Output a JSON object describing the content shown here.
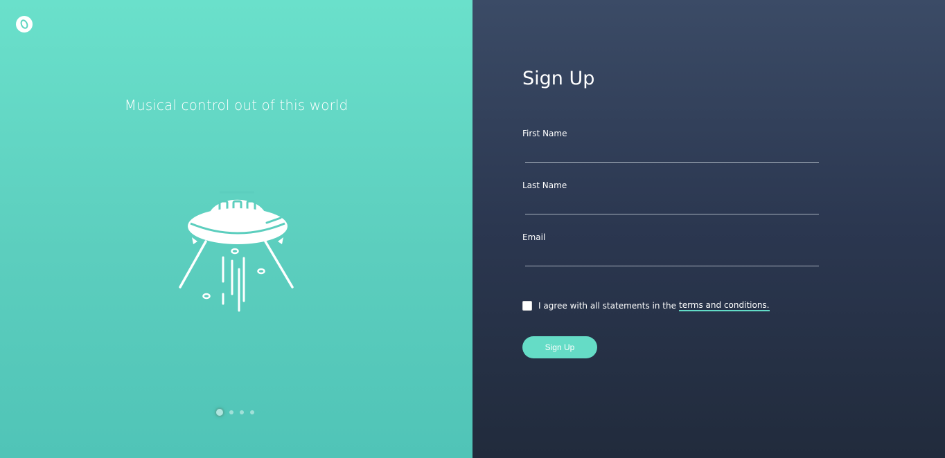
{
  "left": {
    "tagline": "Musical control out of this world",
    "carousel_dots": 4,
    "active_dot": 1
  },
  "form": {
    "title": "Sign Up",
    "fields": [
      {
        "label": "First Name",
        "value": "",
        "placeholder": ""
      },
      {
        "label": "Last Name",
        "value": "",
        "placeholder": ""
      },
      {
        "label": "Email",
        "value": "",
        "placeholder": ""
      }
    ],
    "agree_text": "I agree with all statements in the",
    "terms_link": "terms and conditions.",
    "submit_label": "Sign Up"
  },
  "colors": {
    "accent": "#65dcc6",
    "left_bg_top": "#6ae0cb",
    "left_bg_bottom": "#50c4b7",
    "right_bg_top": "#3b4b66",
    "right_bg_bottom": "#212b3c"
  },
  "icons": {
    "logo": "logo-icon",
    "illustration": "ufo-illustration"
  }
}
